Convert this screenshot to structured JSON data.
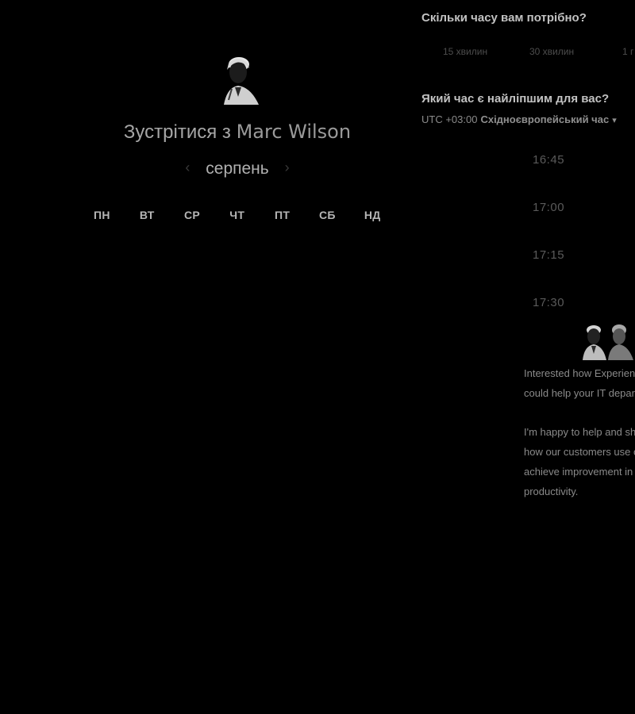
{
  "host": {
    "title_prefix": "Зустрітися з",
    "name": "Marc Wilson"
  },
  "calendar": {
    "month": "серпень",
    "prev_icon": "chevron-left-icon",
    "next_icon": "chevron-right-icon",
    "weekdays": [
      "ПН",
      "ВТ",
      "СР",
      "ЧТ",
      "ПТ",
      "СБ",
      "НД"
    ],
    "weeks": [
      [
        "",
        "",
        "",
        "",
        "",
        "",
        ""
      ],
      [
        "",
        "",
        "",
        "",
        "",
        "",
        ""
      ],
      [
        "",
        "",
        "",
        "",
        "",
        "",
        ""
      ],
      [
        "",
        "",
        "",
        "",
        "",
        "",
        ""
      ],
      [
        "",
        "",
        "",
        "",
        "",
        "",
        ""
      ]
    ]
  },
  "duration": {
    "heading": "Скільки часу вам потрібно?",
    "options": [
      "15 хвилин",
      "30 хвилин",
      "1 г"
    ]
  },
  "schedule": {
    "heading": "Який час є найліпшим для вас?",
    "timezone_offset": "UTC +03:00",
    "timezone_name": "Східноєвропейський час",
    "timezone_caret_icon": "caret-down-icon",
    "slots": [
      "16:45",
      "17:00",
      "17:15",
      "17:30"
    ]
  },
  "message": {
    "paragraph_1": "Interested how Experience Management could help your IT department?",
    "paragraph_2": "I'm happy to help and share insight into how our customers use our platform to achieve improvement in IT end-user productivity."
  },
  "colors": {
    "background": "#000000",
    "heading_text": "#c2c2c2",
    "muted_text": "#5a5a5a"
  }
}
